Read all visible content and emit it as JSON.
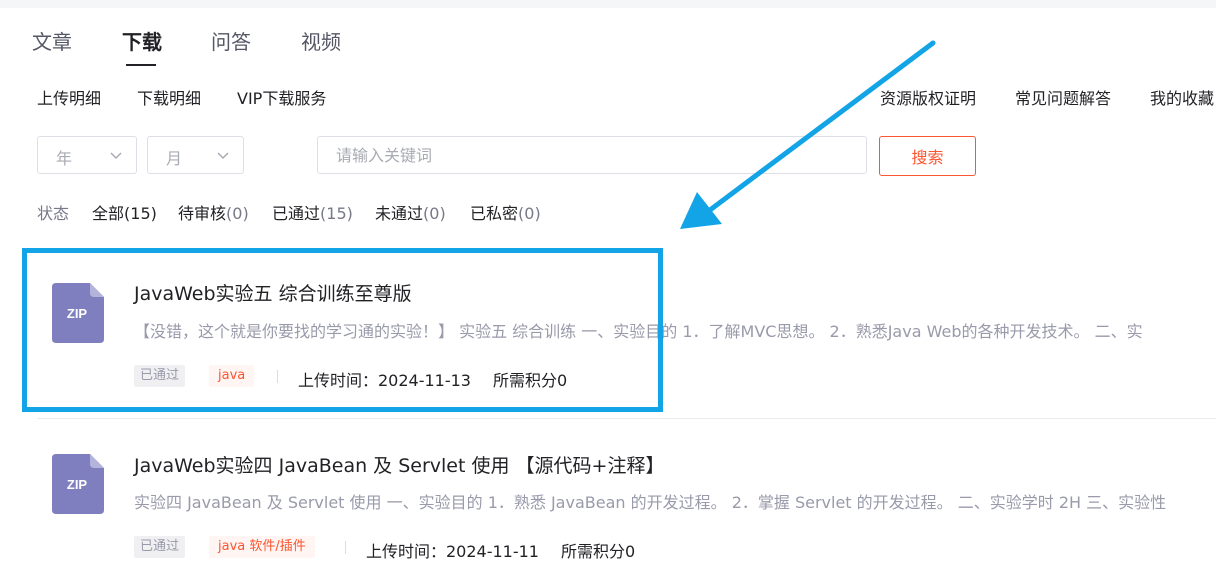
{
  "tabs": [
    "文章",
    "下载",
    "问答",
    "视频"
  ],
  "active_tab": "下载",
  "subnav_left": [
    "上传明细",
    "下载明细",
    "VIP下载服务"
  ],
  "subnav_right": [
    "资源版权证明",
    "常见问题解答",
    "我的收藏"
  ],
  "filters": {
    "year_placeholder": "年",
    "month_placeholder": "月",
    "search_placeholder": "请输入关键词",
    "search_button": "搜索"
  },
  "status": {
    "label": "状态",
    "items": [
      {
        "name": "全部",
        "count": "(15)"
      },
      {
        "name": "待审核",
        "count": "(0)"
      },
      {
        "name": "已通过",
        "count": "(15)"
      },
      {
        "name": "未通过",
        "count": "(0)"
      },
      {
        "name": "已私密",
        "count": "(0)"
      }
    ]
  },
  "items": [
    {
      "icon_label": "ZIP",
      "title": "JavaWeb实验五 综合训练至尊版",
      "desc": "【没错，这个就是你要找的学习通的实验！】 实验五 综合训练 一、实验目的 1．了解MVC思想。 2．熟悉Java Web的各种开发技术。 二、实",
      "status_tag": "已通过",
      "category_tag": "java",
      "upload_time": "上传时间：2024-11-13",
      "points": "所需积分0"
    },
    {
      "icon_label": "ZIP",
      "title": "JavaWeb实验四 JavaBean 及 Servlet 使用 【源代码+注释】",
      "desc": "实验四 JavaBean 及 Servlet 使用 一、实验目的 1．熟悉 JavaBean 的开发过程。 2．掌握 Servlet 的开发过程。 二、实验学时 2H 三、实验性",
      "status_tag": "已通过",
      "category_tag": "java 软件/插件",
      "upload_time": "上传时间：2024-11-11",
      "points": "所需积分0"
    }
  ],
  "colors": {
    "accent": "#fc5531",
    "annotation": "#12a4e6",
    "zip_icon": "#7f7fbf"
  }
}
